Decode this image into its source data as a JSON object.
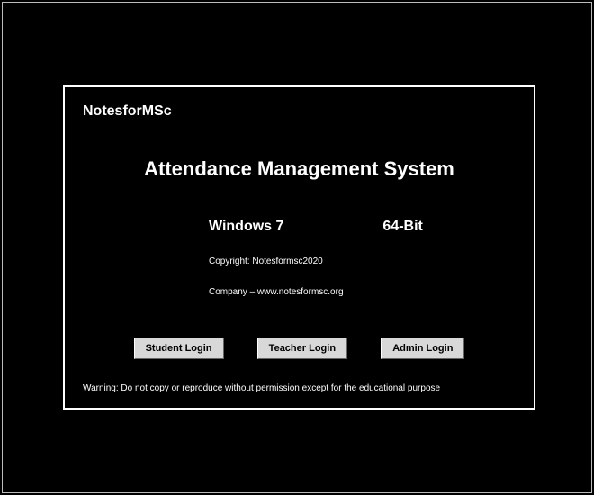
{
  "brand": "NotesforMSc",
  "title": "Attendance Management System",
  "os": {
    "name": "Windows 7",
    "bits": "64-Bit"
  },
  "copyright": "Copyright: Notesformsc2020",
  "company": "Company – www.notesformsc.org",
  "buttons": {
    "student": "Student Login",
    "teacher": "Teacher Login",
    "admin": "Admin Login"
  },
  "warning": "Warning: Do not copy or reproduce without permission except for the educational purpose"
}
